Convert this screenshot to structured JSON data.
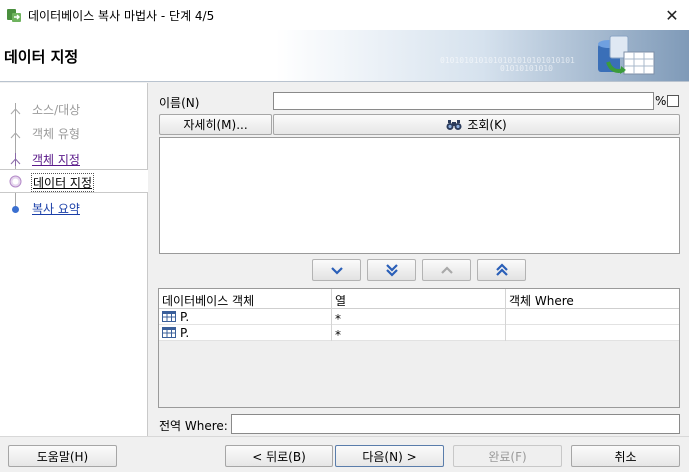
{
  "window": {
    "title": "데이터베이스 복사 마법사 - 단계 4/5",
    "close_glyph": "✕"
  },
  "header": {
    "title": "데이터 지정",
    "binary_a": "0101010101010101010101010101",
    "binary_b": "01010101010"
  },
  "nav": {
    "items": [
      {
        "label": "소스/대상",
        "state": "done"
      },
      {
        "label": "객체 유형",
        "state": "done"
      },
      {
        "label": "객체 지정",
        "state": "visited"
      },
      {
        "label": "데이터 지정",
        "state": "current"
      },
      {
        "label": "복사 요약",
        "state": "future"
      }
    ]
  },
  "form": {
    "name_label": "이름(N)",
    "name_value": "",
    "percent": "%",
    "details_button": "자세히(M)...",
    "lookup_button": "조회(K)",
    "global_where_label": "전역 Where:",
    "global_where_value": ""
  },
  "table": {
    "columns": [
      "데이터베이스 객체",
      "열",
      "객체 Where"
    ],
    "rows": [
      {
        "object": "P.",
        "columns": "*",
        "where": ""
      },
      {
        "object": "P.",
        "columns": "*",
        "where": ""
      }
    ]
  },
  "footer": {
    "help": "도움말(H)",
    "back": "< 뒤로(B)",
    "next": "다음(N) >",
    "finish": "완료(F)",
    "cancel": "취소"
  },
  "colors": {
    "accent": "#5a7dab",
    "visited_link": "#5a1a8a",
    "future_link": "#1a3fa8"
  }
}
